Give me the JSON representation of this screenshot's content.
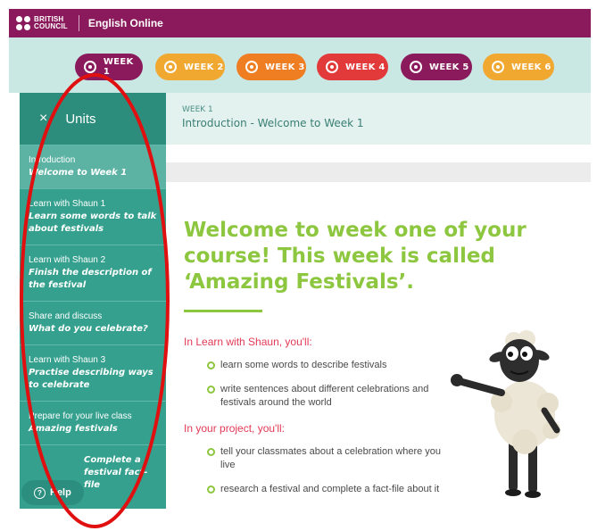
{
  "header": {
    "logo_line1": "BRITISH",
    "logo_line2": "COUNCIL",
    "app_title": "English Online"
  },
  "weeks": [
    {
      "label": "WEEK 1",
      "color": "#8a1a5c",
      "active": true
    },
    {
      "label": "WEEK 2",
      "color": "#f0a830",
      "active": false
    },
    {
      "label": "WEEK 3",
      "color": "#ef7d22",
      "active": false
    },
    {
      "label": "WEEK 4",
      "color": "#e23a3a",
      "active": false
    },
    {
      "label": "WEEK 5",
      "color": "#8a1a5c",
      "active": false
    },
    {
      "label": "WEEK 6",
      "color": "#f0a830",
      "active": false
    }
  ],
  "sidebar": {
    "close_icon": "×",
    "title": "Units",
    "items": [
      {
        "category": "Introduction",
        "title": "Welcome to Week 1",
        "active": true
      },
      {
        "category": "Learn with Shaun 1",
        "title": "Learn some words to talk about festivals"
      },
      {
        "category": "Learn with Shaun 2",
        "title": "Finish the description of the festival"
      },
      {
        "category": "Share and discuss",
        "title": "What do you celebrate?"
      },
      {
        "category": "Learn with Shaun 3",
        "title": "Practise describing ways to celebrate"
      },
      {
        "category": "Prepare for your live class",
        "title": "Amazing festivals"
      },
      {
        "category": "",
        "title": "Complete a festival fact-file"
      }
    ],
    "help_label": "Help"
  },
  "breadcrumb": {
    "week": "WEEK 1",
    "title": "Introduction - Welcome to Week 1"
  },
  "content": {
    "headline": "Welcome to week one of your course! This week is called ‘Amazing Festivals’.",
    "section1_label": "In Learn with Shaun, you'll:",
    "section1_bullets": [
      "learn some words to describe festivals",
      "write sentences about different celebrations and festivals around the world"
    ],
    "section2_label": "In your project, you'll:",
    "section2_bullets": [
      "tell your classmates about a celebration where you live",
      "research a festival and complete a fact-file about it"
    ]
  },
  "colors": {
    "brand": "#8a1a5c",
    "sidebar": "#35a08e",
    "headline": "#8dc63f",
    "section_label": "#e23a56",
    "annotation": "#e01010"
  }
}
